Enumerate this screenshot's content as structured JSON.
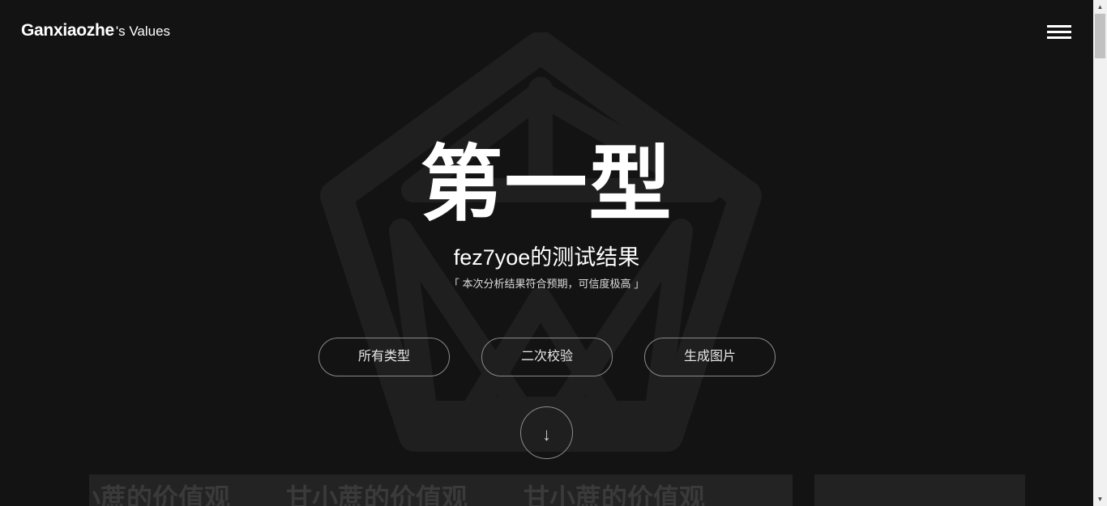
{
  "header": {
    "brand_name": "Ganxiaozhe",
    "brand_suffix": "'s Values",
    "menu_icon": "hamburger-menu-icon"
  },
  "hero": {
    "title": "第一型",
    "subtitle": "fez7yoe的测试结果",
    "note": "「 本次分析结果符合预期，可信度极高 」"
  },
  "actions": {
    "all_types": "所有类型",
    "recheck": "二次校验",
    "generate_image": "生成图片"
  },
  "scroll_down": {
    "icon": "arrow-down-icon",
    "glyph": "↓"
  },
  "content_card": {
    "marquee": [
      "甘小蔗的价值观",
      "甘小蔗的价值观",
      "甘小蔗的价值观"
    ]
  },
  "colors": {
    "background": "#131313",
    "logo": "#1f1f1f",
    "text": "#ffffff",
    "button_border": "#8a8a8a"
  }
}
